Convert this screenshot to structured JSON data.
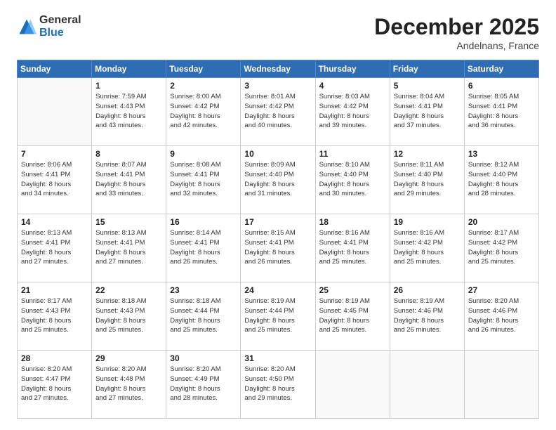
{
  "logo": {
    "general": "General",
    "blue": "Blue"
  },
  "header": {
    "month": "December 2025",
    "location": "Andelnans, France"
  },
  "weekdays": [
    "Sunday",
    "Monday",
    "Tuesday",
    "Wednesday",
    "Thursday",
    "Friday",
    "Saturday"
  ],
  "weeks": [
    [
      {
        "day": "",
        "sunrise": "",
        "sunset": "",
        "daylight": ""
      },
      {
        "day": "1",
        "sunrise": "Sunrise: 7:59 AM",
        "sunset": "Sunset: 4:43 PM",
        "daylight": "Daylight: 8 hours and 43 minutes."
      },
      {
        "day": "2",
        "sunrise": "Sunrise: 8:00 AM",
        "sunset": "Sunset: 4:42 PM",
        "daylight": "Daylight: 8 hours and 42 minutes."
      },
      {
        "day": "3",
        "sunrise": "Sunrise: 8:01 AM",
        "sunset": "Sunset: 4:42 PM",
        "daylight": "Daylight: 8 hours and 40 minutes."
      },
      {
        "day": "4",
        "sunrise": "Sunrise: 8:03 AM",
        "sunset": "Sunset: 4:42 PM",
        "daylight": "Daylight: 8 hours and 39 minutes."
      },
      {
        "day": "5",
        "sunrise": "Sunrise: 8:04 AM",
        "sunset": "Sunset: 4:41 PM",
        "daylight": "Daylight: 8 hours and 37 minutes."
      },
      {
        "day": "6",
        "sunrise": "Sunrise: 8:05 AM",
        "sunset": "Sunset: 4:41 PM",
        "daylight": "Daylight: 8 hours and 36 minutes."
      }
    ],
    [
      {
        "day": "7",
        "sunrise": "Sunrise: 8:06 AM",
        "sunset": "Sunset: 4:41 PM",
        "daylight": "Daylight: 8 hours and 34 minutes."
      },
      {
        "day": "8",
        "sunrise": "Sunrise: 8:07 AM",
        "sunset": "Sunset: 4:41 PM",
        "daylight": "Daylight: 8 hours and 33 minutes."
      },
      {
        "day": "9",
        "sunrise": "Sunrise: 8:08 AM",
        "sunset": "Sunset: 4:41 PM",
        "daylight": "Daylight: 8 hours and 32 minutes."
      },
      {
        "day": "10",
        "sunrise": "Sunrise: 8:09 AM",
        "sunset": "Sunset: 4:40 PM",
        "daylight": "Daylight: 8 hours and 31 minutes."
      },
      {
        "day": "11",
        "sunrise": "Sunrise: 8:10 AM",
        "sunset": "Sunset: 4:40 PM",
        "daylight": "Daylight: 8 hours and 30 minutes."
      },
      {
        "day": "12",
        "sunrise": "Sunrise: 8:11 AM",
        "sunset": "Sunset: 4:40 PM",
        "daylight": "Daylight: 8 hours and 29 minutes."
      },
      {
        "day": "13",
        "sunrise": "Sunrise: 8:12 AM",
        "sunset": "Sunset: 4:40 PM",
        "daylight": "Daylight: 8 hours and 28 minutes."
      }
    ],
    [
      {
        "day": "14",
        "sunrise": "Sunrise: 8:13 AM",
        "sunset": "Sunset: 4:41 PM",
        "daylight": "Daylight: 8 hours and 27 minutes."
      },
      {
        "day": "15",
        "sunrise": "Sunrise: 8:13 AM",
        "sunset": "Sunset: 4:41 PM",
        "daylight": "Daylight: 8 hours and 27 minutes."
      },
      {
        "day": "16",
        "sunrise": "Sunrise: 8:14 AM",
        "sunset": "Sunset: 4:41 PM",
        "daylight": "Daylight: 8 hours and 26 minutes."
      },
      {
        "day": "17",
        "sunrise": "Sunrise: 8:15 AM",
        "sunset": "Sunset: 4:41 PM",
        "daylight": "Daylight: 8 hours and 26 minutes."
      },
      {
        "day": "18",
        "sunrise": "Sunrise: 8:16 AM",
        "sunset": "Sunset: 4:41 PM",
        "daylight": "Daylight: 8 hours and 25 minutes."
      },
      {
        "day": "19",
        "sunrise": "Sunrise: 8:16 AM",
        "sunset": "Sunset: 4:42 PM",
        "daylight": "Daylight: 8 hours and 25 minutes."
      },
      {
        "day": "20",
        "sunrise": "Sunrise: 8:17 AM",
        "sunset": "Sunset: 4:42 PM",
        "daylight": "Daylight: 8 hours and 25 minutes."
      }
    ],
    [
      {
        "day": "21",
        "sunrise": "Sunrise: 8:17 AM",
        "sunset": "Sunset: 4:43 PM",
        "daylight": "Daylight: 8 hours and 25 minutes."
      },
      {
        "day": "22",
        "sunrise": "Sunrise: 8:18 AM",
        "sunset": "Sunset: 4:43 PM",
        "daylight": "Daylight: 8 hours and 25 minutes."
      },
      {
        "day": "23",
        "sunrise": "Sunrise: 8:18 AM",
        "sunset": "Sunset: 4:44 PM",
        "daylight": "Daylight: 8 hours and 25 minutes."
      },
      {
        "day": "24",
        "sunrise": "Sunrise: 8:19 AM",
        "sunset": "Sunset: 4:44 PM",
        "daylight": "Daylight: 8 hours and 25 minutes."
      },
      {
        "day": "25",
        "sunrise": "Sunrise: 8:19 AM",
        "sunset": "Sunset: 4:45 PM",
        "daylight": "Daylight: 8 hours and 25 minutes."
      },
      {
        "day": "26",
        "sunrise": "Sunrise: 8:19 AM",
        "sunset": "Sunset: 4:46 PM",
        "daylight": "Daylight: 8 hours and 26 minutes."
      },
      {
        "day": "27",
        "sunrise": "Sunrise: 8:20 AM",
        "sunset": "Sunset: 4:46 PM",
        "daylight": "Daylight: 8 hours and 26 minutes."
      }
    ],
    [
      {
        "day": "28",
        "sunrise": "Sunrise: 8:20 AM",
        "sunset": "Sunset: 4:47 PM",
        "daylight": "Daylight: 8 hours and 27 minutes."
      },
      {
        "day": "29",
        "sunrise": "Sunrise: 8:20 AM",
        "sunset": "Sunset: 4:48 PM",
        "daylight": "Daylight: 8 hours and 27 minutes."
      },
      {
        "day": "30",
        "sunrise": "Sunrise: 8:20 AM",
        "sunset": "Sunset: 4:49 PM",
        "daylight": "Daylight: 8 hours and 28 minutes."
      },
      {
        "day": "31",
        "sunrise": "Sunrise: 8:20 AM",
        "sunset": "Sunset: 4:50 PM",
        "daylight": "Daylight: 8 hours and 29 minutes."
      },
      {
        "day": "",
        "sunrise": "",
        "sunset": "",
        "daylight": ""
      },
      {
        "day": "",
        "sunrise": "",
        "sunset": "",
        "daylight": ""
      },
      {
        "day": "",
        "sunrise": "",
        "sunset": "",
        "daylight": ""
      }
    ]
  ]
}
